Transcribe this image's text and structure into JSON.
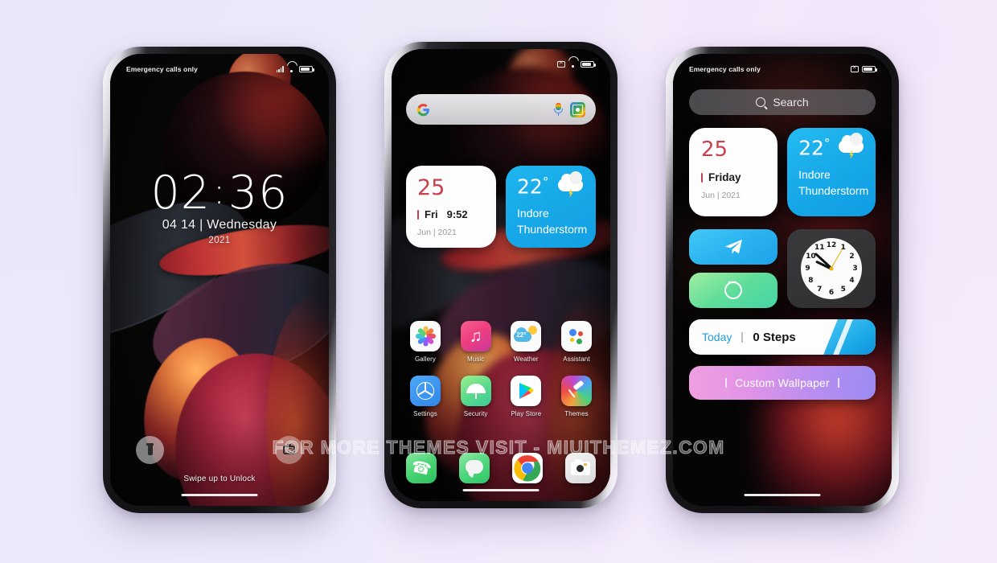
{
  "page": {
    "watermark": "FOR MORE THEMES VISIT - MIUITHEMEZ.COM",
    "background_colors": [
      "#e9e7f8",
      "#f5ebfb"
    ]
  },
  "phone1": {
    "status": {
      "carrier": "Emergency calls only",
      "icons": [
        "signal-icon",
        "wifi-icon",
        "battery-icon"
      ]
    },
    "lockscreen": {
      "time_hours": "02",
      "time_colon": ":",
      "time_minutes": "36",
      "date": "04 14 | Wednesday",
      "year": "2021",
      "torch_icon": "flashlight-icon",
      "camera_icon": "camera-icon",
      "unlock_hint": "Swipe up to Unlock"
    }
  },
  "phone2": {
    "status": {
      "carrier": "",
      "icons": [
        "mute-icon",
        "wifi-icon",
        "battery-icon"
      ]
    },
    "search": {
      "google_icon": "google-logo-icon",
      "mic_icon": "microphone-icon",
      "lens_icon": "google-lens-icon",
      "placeholder": ""
    },
    "calendar_widget": {
      "day": "25",
      "weekday": "Fri",
      "time": "9:52",
      "month_year": "Jun | 2021",
      "accent": "#c8414f"
    },
    "weather_widget": {
      "temp": "22",
      "degree": "°",
      "city": "Indore",
      "condition": "Thunderstorm",
      "icon": "thunderstorm-icon",
      "accent": "#17a9e8"
    },
    "apps": [
      {
        "label": "Gallery",
        "icon": "gallery-icon"
      },
      {
        "label": "Music",
        "icon": "music-icon"
      },
      {
        "label": "Weather",
        "icon": "weather-icon",
        "badge": "22°"
      },
      {
        "label": "Assistant",
        "icon": "google-assistant-icon"
      },
      {
        "label": "Settings",
        "icon": "settings-icon"
      },
      {
        "label": "Security",
        "icon": "security-icon"
      },
      {
        "label": "Play Store",
        "icon": "play-store-icon"
      },
      {
        "label": "Themes",
        "icon": "themes-icon"
      }
    ],
    "dock": [
      {
        "label": "Phone",
        "icon": "phone-icon"
      },
      {
        "label": "Messages",
        "icon": "messages-icon"
      },
      {
        "label": "Chrome",
        "icon": "chrome-icon"
      },
      {
        "label": "Camera",
        "icon": "camera-icon"
      }
    ]
  },
  "phone3": {
    "status": {
      "carrier": "Emergency calls only",
      "icons": [
        "mute-icon",
        "battery-icon"
      ]
    },
    "search": {
      "placeholder": "Search",
      "icon": "search-icon"
    },
    "calendar_widget": {
      "day": "25",
      "weekday": "Friday",
      "month_year": "Jun | 2021",
      "accent": "#c8414f"
    },
    "weather_widget": {
      "temp": "22",
      "degree": "°",
      "city": "Indore",
      "condition": "Thunderstorm",
      "icon": "thunderstorm-icon",
      "accent": "#17a9e8"
    },
    "shortcuts": [
      {
        "name": "Telegram",
        "icon": "telegram-icon"
      },
      {
        "name": "WhatsApp",
        "icon": "whatsapp-icon"
      }
    ],
    "clock_widget": {
      "numerals": [
        "1",
        "2",
        "3",
        "4",
        "5",
        "6",
        "7",
        "8",
        "9",
        "10",
        "11",
        "12"
      ],
      "hour": 9,
      "minute": 52,
      "second": 5,
      "second_hand_color": "#e8b400"
    },
    "steps_widget": {
      "label": "Today",
      "value": "0 Steps",
      "icon": "shoe-icon",
      "accent": "#1f9ed8"
    },
    "custom_wallpaper_widget": {
      "label": "Custom Wallpaper"
    }
  }
}
